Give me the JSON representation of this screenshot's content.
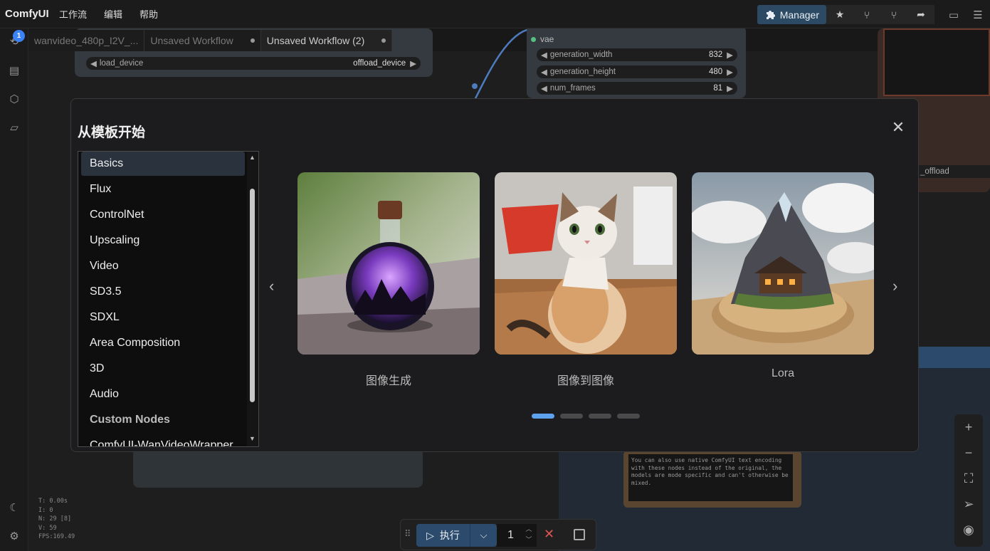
{
  "topbar": {
    "brand": "ComfyUI",
    "menus": [
      "工作流",
      "编辑",
      "帮助"
    ],
    "manager_label": "Manager"
  },
  "sidebar": {
    "queue_badge": "1"
  },
  "tabs": [
    {
      "label": "wanvideo_480p_I2V_..."
    },
    {
      "label": "Unsaved Workflow"
    },
    {
      "label": "Unsaved Workflow (2)"
    }
  ],
  "canvas": {
    "load_device": {
      "label": "load_device",
      "value": "offload_device"
    },
    "vae_label": "vae",
    "generation_width": {
      "label": "generation_width",
      "value": "832"
    },
    "generation_height": {
      "label": "generation_height",
      "value": "480"
    },
    "num_frames": {
      "label": "num_frames",
      "value": "81"
    },
    "offload_fragment": "_offload",
    "note_text": "You can also use native ComfyUI text encoding with these nodes instead of the original, the models are mode specific and can't otherwise be mixed."
  },
  "stats": {
    "t": "T: 0.00s",
    "i": "I: 0",
    "n": "N: 29 [8]",
    "v": "V: 59",
    "fps": "FPS:169.49"
  },
  "modal": {
    "title": "从模板开始",
    "categories": [
      "Basics",
      "Flux",
      "ControlNet",
      "Upscaling",
      "Video",
      "SD3.5",
      "SDXL",
      "Area Composition",
      "3D",
      "Audio"
    ],
    "custom_header": "Custom Nodes",
    "custom_items": [
      "ComfyUI-WanVideoWrapper"
    ],
    "selected_category": "Basics",
    "templates": [
      {
        "label": "图像生成",
        "image": "potion bottle with galaxy inside"
      },
      {
        "label": "图像到图像",
        "image": "cat looking up"
      },
      {
        "label": "Lora",
        "image": "miniature mountain cabin island"
      }
    ],
    "page_count": 4,
    "page_active": 1
  },
  "runbar": {
    "run_label": "执行",
    "batch_count": "1"
  },
  "colors": {
    "accent": "#5ea2ef",
    "run_button": "#2c4a6b",
    "manager": "#2c4a63",
    "stop": "#e05555"
  }
}
